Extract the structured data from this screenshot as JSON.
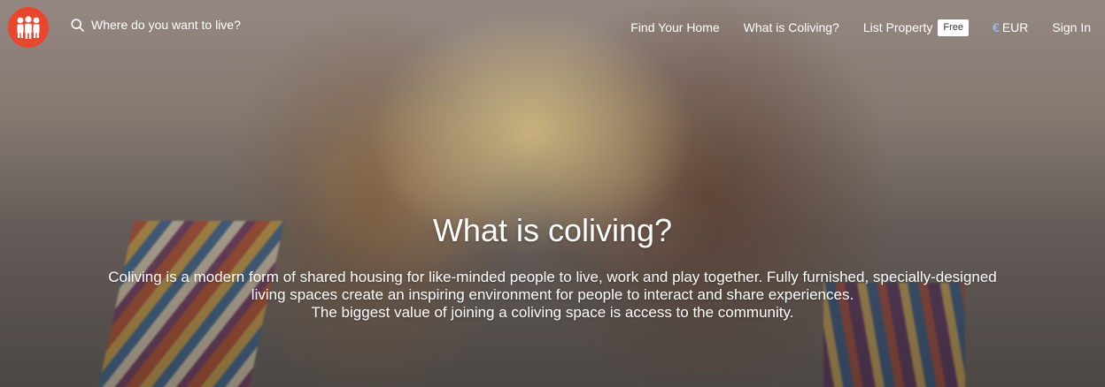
{
  "header": {
    "logo_icon": "people-group-icon",
    "brand_color": "#e8472e",
    "search": {
      "icon": "search-icon",
      "placeholder": "Where do you want to live?"
    },
    "nav": {
      "find_home": "Find Your Home",
      "what_is_coliving": "What is Coliving?",
      "list_property": "List Property",
      "list_property_badge": "Free",
      "currency_symbol": "€",
      "currency": "EUR",
      "sign_in": "Sign In"
    }
  },
  "hero": {
    "title": "What is coliving?",
    "lines": [
      "Coliving is a modern form of shared housing for like-minded people to live, work and play together. Fully furnished, specially-designed",
      "living spaces create an inspiring environment for people to interact and share experiences.",
      "The biggest value of joining a coliving space is access to the community."
    ]
  }
}
